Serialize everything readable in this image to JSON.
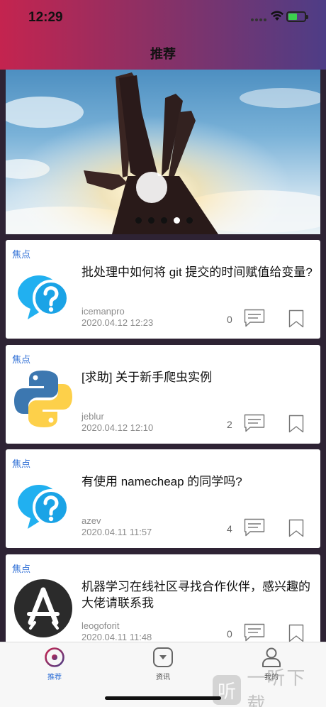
{
  "status_bar": {
    "time": "12:29"
  },
  "header": {
    "title": "推荐"
  },
  "banner": {
    "pages": 5,
    "active_index": 3
  },
  "posts": [
    {
      "tag": "焦点",
      "title": "批处理中如何将 git 提交的时间赋值给变量?",
      "author": "icemanpro",
      "time": "2020.04.12 12:23",
      "comments": "0",
      "icon": "question-bubble-icon"
    },
    {
      "tag": "焦点",
      "title": "[求助] 关于新手爬虫实例",
      "author": "jeblur",
      "time": "2020.04.12 12:10",
      "comments": "2",
      "icon": "python-logo-icon"
    },
    {
      "tag": "焦点",
      "title": "有使用 namecheap 的同学吗?",
      "author": "azev",
      "time": "2020.04.11 11:57",
      "comments": "4",
      "icon": "question-bubble-icon"
    },
    {
      "tag": "焦点",
      "title": "机器学习在线社区寻找合作伙伴，感兴趣的大佬请联系我",
      "author": "leogoforit",
      "time": "2020.04.11 11:48",
      "comments": "0",
      "icon": "app-store-icon"
    }
  ],
  "tabs": [
    {
      "label": "推荐",
      "icon": "target-icon",
      "active": true
    },
    {
      "label": "资讯",
      "icon": "message-icon",
      "active": false
    },
    {
      "label": "我的",
      "icon": "user-icon",
      "active": false
    }
  ],
  "watermark": {
    "text": "一听下载",
    "logo_char": "听"
  },
  "colors": {
    "accent": "#2f6fd6",
    "header_start": "#c4244f",
    "header_end": "#4e3d86"
  }
}
